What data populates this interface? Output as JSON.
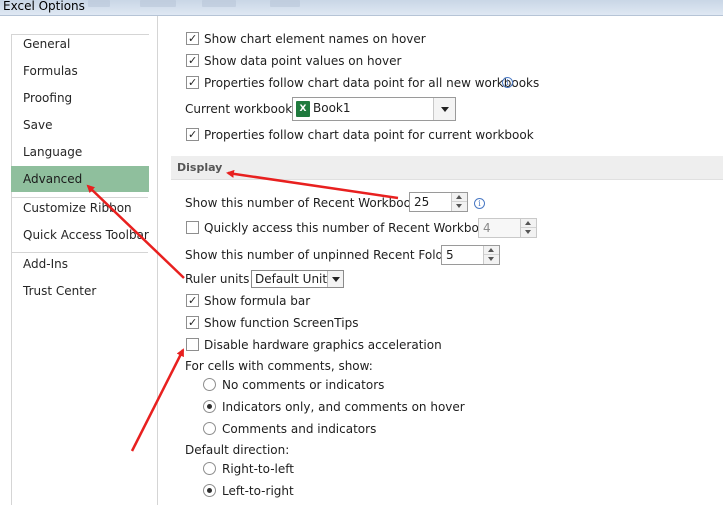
{
  "window": {
    "title": "Excel Options"
  },
  "sidebar": {
    "items": [
      {
        "label": "General"
      },
      {
        "label": "Formulas"
      },
      {
        "label": "Proofing"
      },
      {
        "label": "Save"
      },
      {
        "label": "Language"
      },
      {
        "label": "Advanced",
        "active": true
      },
      {
        "label": "Customize Ribbon"
      },
      {
        "label": "Quick Access Toolbar"
      },
      {
        "label": "Add-Ins"
      },
      {
        "label": "Trust Center"
      }
    ]
  },
  "chart_options": {
    "show_element_names": {
      "label": "Show chart element names on hover",
      "checked": true
    },
    "show_point_values": {
      "label": "Show data point values on hover",
      "checked": true
    },
    "follow_all_new": {
      "label": "Properties follow chart data point for all new workbooks",
      "checked": true
    },
    "current_workbook_label": "Current workbook:",
    "current_workbook_value": "Book1",
    "follow_current": {
      "label": "Properties follow chart data point for current workbook",
      "checked": true
    }
  },
  "display": {
    "header": "Display",
    "recent_workbooks_label": "Show this number of Recent Workbooks:",
    "recent_workbooks_value": "25",
    "quick_access_label": "Quickly access this number of Recent Workbooks:",
    "quick_access_value": "4",
    "quick_access_checked": false,
    "unpinned_folders_label": "Show this number of unpinned Recent Folders:",
    "unpinned_folders_value": "5",
    "ruler_units_label": "Ruler units",
    "ruler_units_value": "Default Units",
    "formula_bar": {
      "label": "Show formula bar",
      "checked": true
    },
    "screentips": {
      "label": "Show function ScreenTips",
      "checked": true
    },
    "hw_accel": {
      "label": "Disable hardware graphics acceleration",
      "checked": false
    },
    "comments_label": "For cells with comments, show:",
    "comments_options": [
      {
        "label": "No comments or indicators",
        "selected": false
      },
      {
        "label": "Indicators only, and comments on hover",
        "selected": true
      },
      {
        "label": "Comments and indicators",
        "selected": false
      }
    ],
    "direction_label": "Default direction:",
    "direction_options": [
      {
        "label": "Right-to-left",
        "selected": false
      },
      {
        "label": "Left-to-right",
        "selected": true
      }
    ]
  },
  "colors": {
    "active_nav": "#8fbf9d",
    "annotation_arrow": "#e8201f",
    "excel_green": "#1f7a3e"
  },
  "icons": {
    "info": "info-icon",
    "workbook": "excel-workbook-icon"
  }
}
